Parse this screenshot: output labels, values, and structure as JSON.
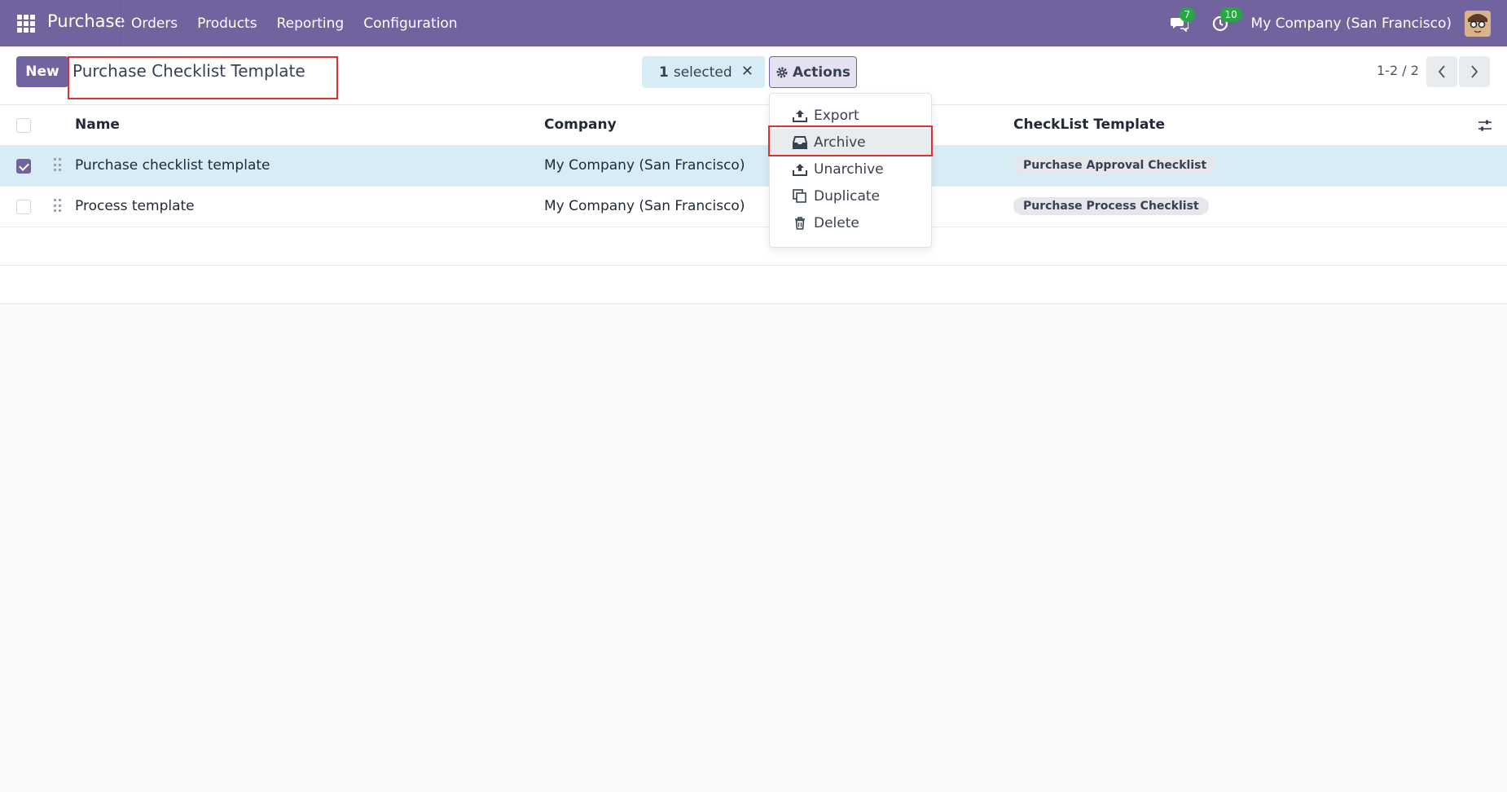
{
  "navbar": {
    "app_name": "Purchase",
    "menu": [
      "Orders",
      "Products",
      "Reporting",
      "Configuration"
    ],
    "messages_count": "7",
    "activities_count": "10",
    "company": "My Company (San Francisco)"
  },
  "control": {
    "new_label": "New",
    "title": "Purchase Checklist Template",
    "selected_count": "1",
    "selected_label": "selected",
    "actions_label": "Actions",
    "pager": "1-2 / 2"
  },
  "table": {
    "columns": [
      "Name",
      "Company",
      "CheckList Template"
    ],
    "rows": [
      {
        "name": "Purchase checklist template",
        "company": "My Company (San Francisco)",
        "template": "Purchase Approval Checklist",
        "selected": true
      },
      {
        "name": "Process template",
        "company": "My Company (San Francisco)",
        "template": "Purchase Process Checklist",
        "selected": false
      }
    ]
  },
  "actions_menu": {
    "items": [
      "Export",
      "Archive",
      "Unarchive",
      "Duplicate",
      "Delete"
    ],
    "highlighted": "Archive"
  },
  "colors": {
    "brand": "#71639e",
    "selection": "#d8ecf5",
    "highlight_box": "#e03131",
    "badge": "#28a745"
  }
}
